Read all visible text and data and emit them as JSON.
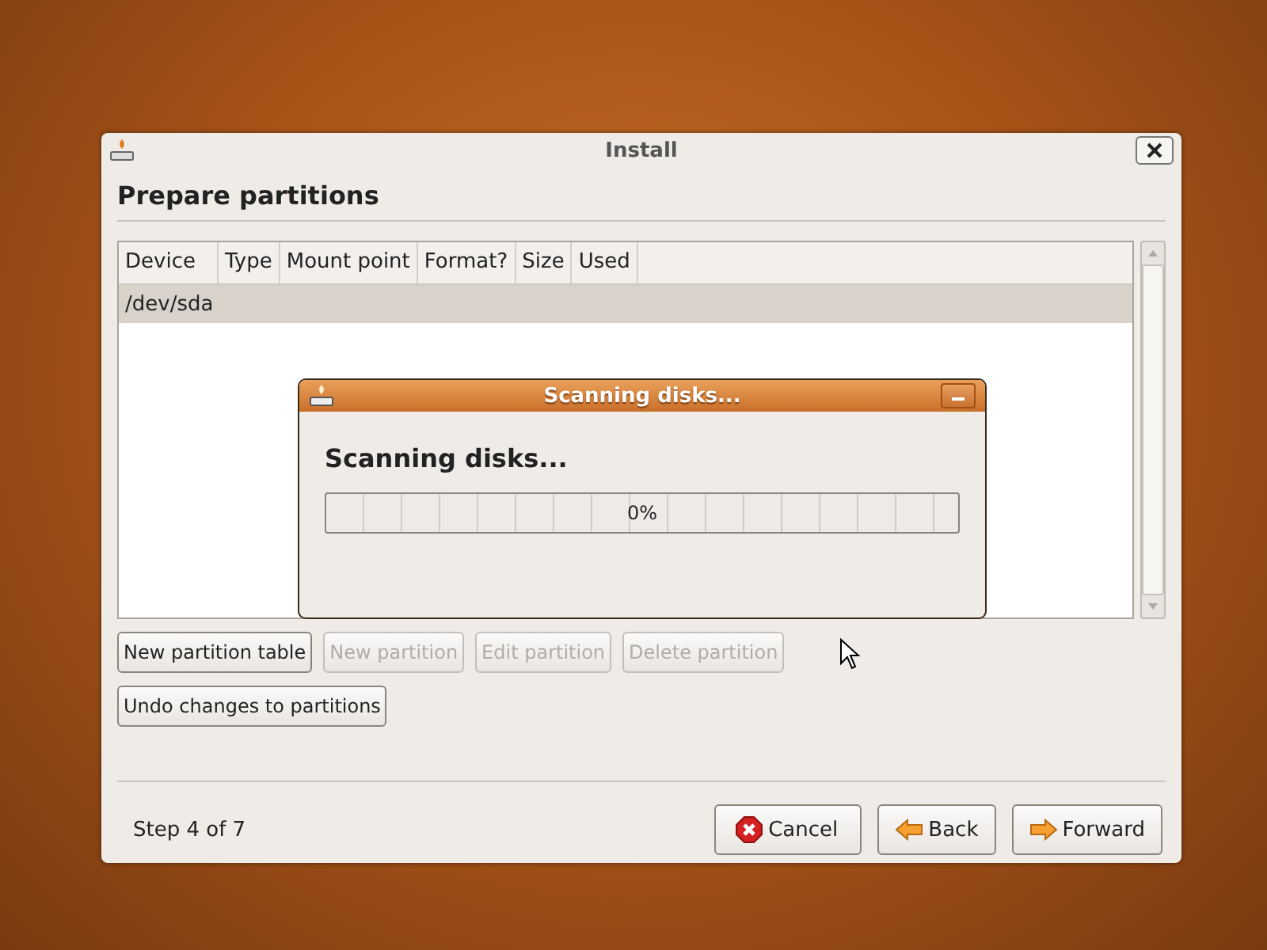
{
  "window": {
    "title": "Install"
  },
  "heading": "Prepare partitions",
  "table": {
    "columns": [
      "Device",
      "Type",
      "Mount point",
      "Format?",
      "Size",
      "Used"
    ],
    "rows": [
      {
        "cells": [
          "/dev/sda"
        ],
        "selected": true
      }
    ]
  },
  "partition_buttons": [
    {
      "label": "New partition table",
      "disabled": false
    },
    {
      "label": "New partition",
      "disabled": true
    },
    {
      "label": "Edit partition",
      "disabled": true
    },
    {
      "label": "Delete partition",
      "disabled": true
    }
  ],
  "undo_button": {
    "label": "Undo changes to partitions",
    "disabled": false
  },
  "step": "Step 4 of 7",
  "nav_buttons": [
    {
      "label": "Cancel",
      "kind": "cancel"
    },
    {
      "label": "Back",
      "kind": "back"
    },
    {
      "label": "Forward",
      "kind": "forward"
    }
  ],
  "progress_dialog": {
    "title": "Scanning disks...",
    "message": "Scanning disks...",
    "progress": {
      "level": 0,
      "reading": "0%"
    }
  }
}
